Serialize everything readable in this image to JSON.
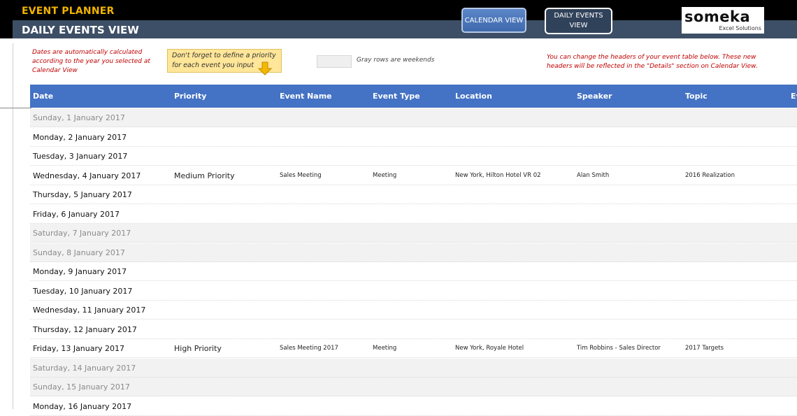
{
  "app": {
    "title": "EVENT PLANNER",
    "view_title": "DAILY EVENTS VIEW"
  },
  "nav": {
    "calendar_view_label": "CALENDAR VIEW",
    "daily_events_view_label": "DAILY EVENTS VIEW"
  },
  "logo": {
    "wordmark": "someka",
    "tagline": "Excel Solutions"
  },
  "notes": {
    "dates_note": "Dates are automatically calculated according to the year you selected at Calendar View",
    "priority_note": "Don't forget to define a priority for each event you input",
    "gray_rows_note": "Gray rows are weekends",
    "headers_note": "You can change the headers of your event table below. These new headers will be reflected in the \"Details\" section on Calendar View."
  },
  "colors": {
    "accent_blue": "#4472c4",
    "band": "#3d4f66",
    "title_gold": "#f0b400",
    "note_red": "#c00000",
    "weekend_gray": "#f2f2f2"
  },
  "table": {
    "columns": [
      "Date",
      "Priority",
      "Event Name",
      "Event Type",
      "Location",
      "Speaker",
      "Topic",
      "Ev"
    ],
    "rows": [
      {
        "date": "Sunday, 1 January 2017",
        "weekend": true,
        "priority": "",
        "event_name": "",
        "event_type": "",
        "location": "",
        "speaker": "",
        "topic": ""
      },
      {
        "date": "Monday, 2 January 2017",
        "weekend": false,
        "priority": "",
        "event_name": "",
        "event_type": "",
        "location": "",
        "speaker": "",
        "topic": ""
      },
      {
        "date": "Tuesday, 3 January 2017",
        "weekend": false,
        "priority": "",
        "event_name": "",
        "event_type": "",
        "location": "",
        "speaker": "",
        "topic": ""
      },
      {
        "date": "Wednesday, 4 January 2017",
        "weekend": false,
        "priority": "Medium Priority",
        "event_name": "Sales Meeting",
        "event_type": "Meeting",
        "location": "New York, Hilton Hotel VR 02",
        "speaker": "Alan Smith",
        "topic": "2016 Realization"
      },
      {
        "date": "Thursday, 5 January 2017",
        "weekend": false,
        "priority": "",
        "event_name": "",
        "event_type": "",
        "location": "",
        "speaker": "",
        "topic": ""
      },
      {
        "date": "Friday, 6 January 2017",
        "weekend": false,
        "priority": "",
        "event_name": "",
        "event_type": "",
        "location": "",
        "speaker": "",
        "topic": ""
      },
      {
        "date": "Saturday, 7 January 2017",
        "weekend": true,
        "priority": "",
        "event_name": "",
        "event_type": "",
        "location": "",
        "speaker": "",
        "topic": ""
      },
      {
        "date": "Sunday, 8 January 2017",
        "weekend": true,
        "priority": "",
        "event_name": "",
        "event_type": "",
        "location": "",
        "speaker": "",
        "topic": ""
      },
      {
        "date": "Monday, 9 January 2017",
        "weekend": false,
        "priority": "",
        "event_name": "",
        "event_type": "",
        "location": "",
        "speaker": "",
        "topic": ""
      },
      {
        "date": "Tuesday, 10 January 2017",
        "weekend": false,
        "priority": "",
        "event_name": "",
        "event_type": "",
        "location": "",
        "speaker": "",
        "topic": ""
      },
      {
        "date": "Wednesday, 11 January 2017",
        "weekend": false,
        "priority": "",
        "event_name": "",
        "event_type": "",
        "location": "",
        "speaker": "",
        "topic": ""
      },
      {
        "date": "Thursday, 12 January 2017",
        "weekend": false,
        "priority": "",
        "event_name": "",
        "event_type": "",
        "location": "",
        "speaker": "",
        "topic": ""
      },
      {
        "date": "Friday, 13 January 2017",
        "weekend": false,
        "priority": "High Priority",
        "event_name": "Sales Meeting 2017",
        "event_type": "Meeting",
        "location": "New York, Royale Hotel",
        "speaker": "Tim Robbins - Sales Director",
        "topic": "2017 Targets"
      },
      {
        "date": "Saturday, 14 January 2017",
        "weekend": true,
        "priority": "",
        "event_name": "",
        "event_type": "",
        "location": "",
        "speaker": "",
        "topic": ""
      },
      {
        "date": "Sunday, 15 January 2017",
        "weekend": true,
        "priority": "",
        "event_name": "",
        "event_type": "",
        "location": "",
        "speaker": "",
        "topic": ""
      },
      {
        "date": "Monday, 16 January 2017",
        "weekend": false,
        "priority": "",
        "event_name": "",
        "event_type": "",
        "location": "",
        "speaker": "",
        "topic": ""
      }
    ]
  }
}
